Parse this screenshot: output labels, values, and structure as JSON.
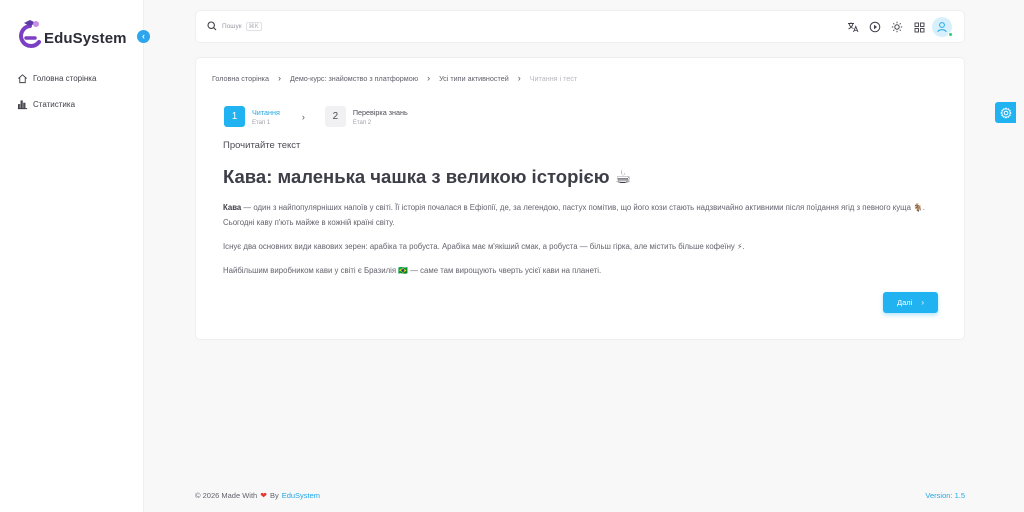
{
  "app": {
    "name": "EduSystem"
  },
  "sidebar": {
    "items": [
      {
        "label": "Головна сторінка",
        "icon": "home-icon"
      },
      {
        "label": "Статистика",
        "icon": "chart-icon"
      }
    ]
  },
  "topbar": {
    "search_placeholder": "Пошук",
    "search_shortcut": "⌘K",
    "icons": [
      "translate-icon",
      "play-icon",
      "sun-icon",
      "grid-icon",
      "user-icon"
    ]
  },
  "breadcrumb": {
    "items": [
      "Головна сторінка",
      "Демо-курс: знайомство з платформою",
      "Усі типи активностей",
      "Читання і тест"
    ]
  },
  "stepper": {
    "steps": [
      {
        "number": "1",
        "title": "Читання",
        "subtitle": "Етап 1"
      },
      {
        "number": "2",
        "title": "Перевірка знань",
        "subtitle": "Етап 2"
      }
    ]
  },
  "content": {
    "instruction": "Прочитайте текст",
    "title": "Кава: маленька чашка з великою історією ☕",
    "p1_bold": "Кава",
    "p1_rest": " — один з найпопулярніших напоїв у світі. Її історія почалася в Ефіопії, де, за легендою, пастух помітив, що його кози стають надзвичайно активними після поїдання ягід з певного куща 🐐. Сьогодні каву п'ють майже в кожній країні світу.",
    "p2": "Існує два основних види кавових зерен: арабіка та робуста. Арабіка має м'якіший смак, а робуста — більш гірка, але містить більше кофеїну ⚡.",
    "p3": "Найбільшим виробником кави у світі є Бразилія 🇧🇷 — саме там вирощують чверть усієї кави на планеті.",
    "next_label": "Далі"
  },
  "footer": {
    "prefix": "© 2026 Made With",
    "by": "By",
    "brand": "EduSystem",
    "version": "Version: 1.5"
  },
  "colors": {
    "accent": "#21b2f2",
    "brand_purple": "#7b3fc4",
    "heart": "#e53935"
  }
}
